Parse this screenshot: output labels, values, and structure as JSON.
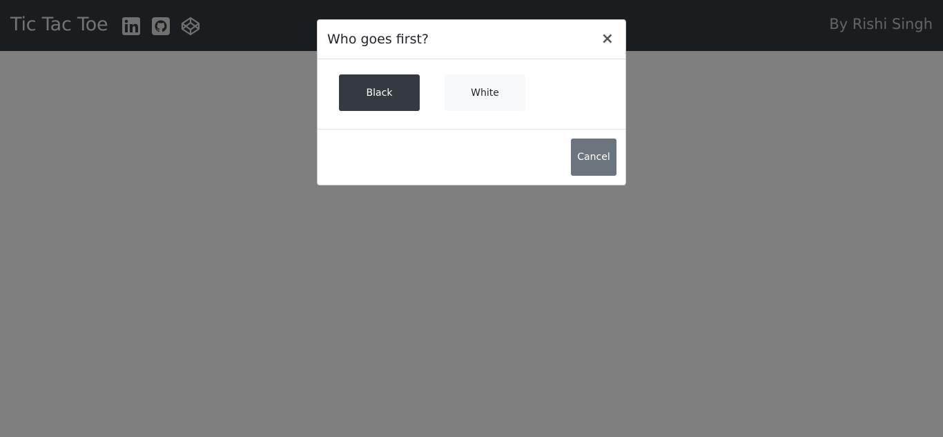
{
  "navbar": {
    "brand": "Tic Tac Toe",
    "author": "By Rishi Singh",
    "icons": [
      "linkedin-icon",
      "github-icon",
      "codepen-icon"
    ]
  },
  "modal": {
    "title": "Who goes first?",
    "close_label": "×",
    "options": {
      "black_label": "Black",
      "white_label": "White"
    },
    "cancel_label": "Cancel"
  },
  "colors": {
    "navbar_bg": "#343a40",
    "overlay": "rgba(0,0,0,0.5)",
    "black_button": "#343a40",
    "white_button": "#f8f9fa",
    "cancel_button": "#6c757d"
  }
}
